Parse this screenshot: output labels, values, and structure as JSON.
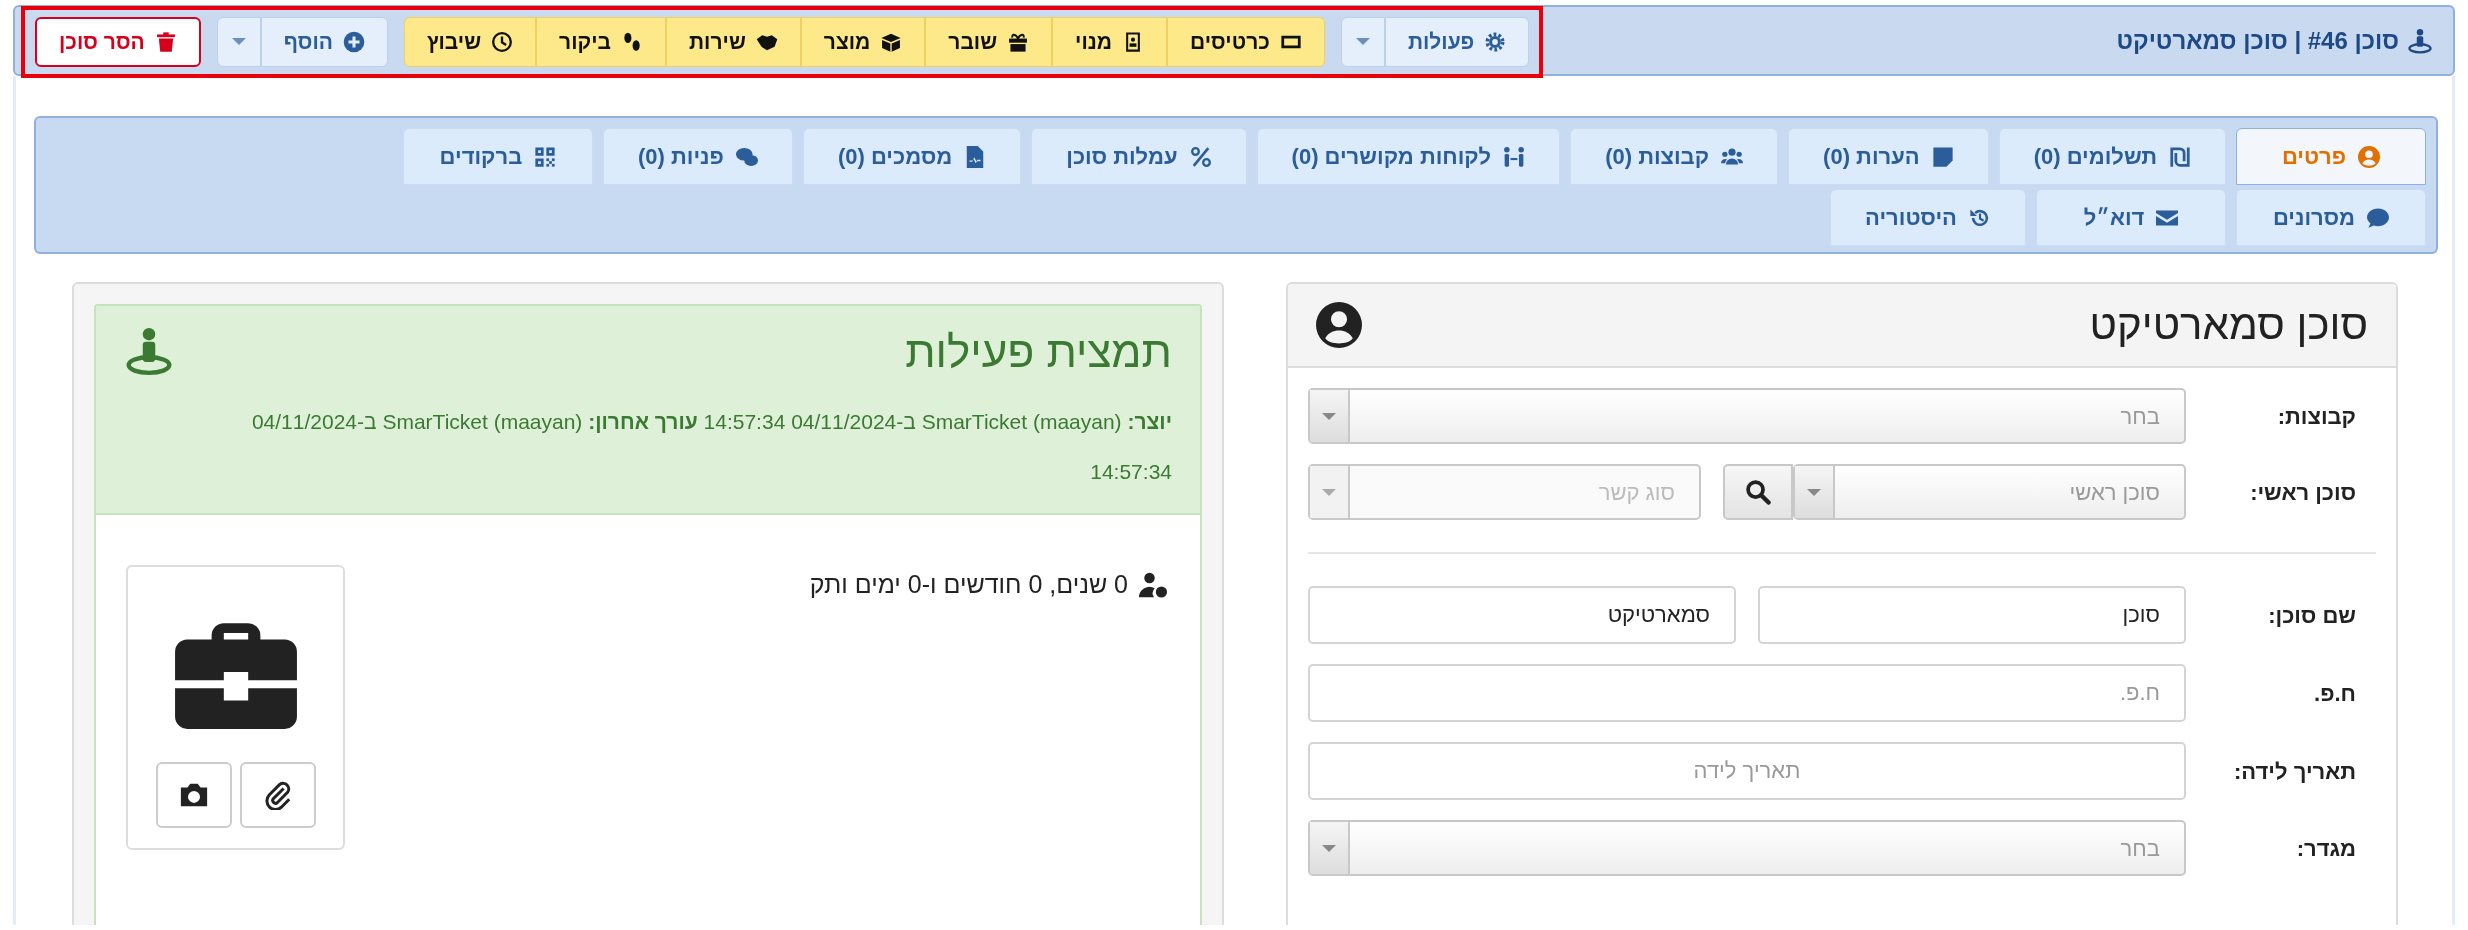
{
  "header": {
    "title": "סוכן #46 | סוכן סמארטיקט"
  },
  "toolbar": {
    "highlighted": true,
    "actions_button": {
      "label": "פעולות"
    },
    "quick_buttons": [
      {
        "label": "כרטיסים"
      },
      {
        "label": "מנוי"
      },
      {
        "label": "שובר"
      },
      {
        "label": "מוצר"
      },
      {
        "label": "שירות"
      },
      {
        "label": "ביקור"
      },
      {
        "label": "שיבוץ"
      }
    ],
    "add_button": {
      "label": "הוסף"
    },
    "remove_button": {
      "label": "הסר סוכן"
    }
  },
  "tab_rows": [
    [
      {
        "label": "פרטים",
        "selected": true
      },
      {
        "label": "תשלומים (0)",
        "selected": false
      },
      {
        "label": "הערות (0)",
        "selected": false
      },
      {
        "label": "קבוצות (0)",
        "selected": false
      },
      {
        "label": "לקוחות מקושרים (0)",
        "selected": false
      },
      {
        "label": "עמלות סוכן",
        "selected": false
      },
      {
        "label": "מסמכים (0)",
        "selected": false
      },
      {
        "label": "פניות (0)",
        "selected": false
      },
      {
        "label": "ברקודים",
        "selected": false
      }
    ],
    [
      {
        "label": "מסרונים",
        "selected": false
      },
      {
        "label": "דוא״ל",
        "selected": false
      },
      {
        "label": "היסטוריה",
        "selected": false
      }
    ]
  ],
  "agent_card": {
    "title": "סוכן סמארטיקט",
    "rows": [
      {
        "kind": "field",
        "label": "קבוצות:",
        "controls": [
          {
            "kind": "select",
            "placeholder": "בחר",
            "disabled": false
          }
        ]
      },
      {
        "kind": "field",
        "label": "סוכן ראשי:",
        "controls": [
          {
            "kind": "select",
            "placeholder": "סוכן ראשי",
            "disabled": false
          },
          {
            "kind": "search_button"
          },
          {
            "kind": "select",
            "placeholder": "סוג קשר",
            "disabled": true
          }
        ]
      },
      {
        "kind": "divider"
      },
      {
        "kind": "field",
        "label": "שם סוכן:",
        "controls": [
          {
            "kind": "input",
            "value": "סוכן"
          },
          {
            "kind": "input",
            "value": "סמארטיקט"
          }
        ]
      },
      {
        "kind": "field",
        "label": "ח.פ.",
        "controls": [
          {
            "kind": "input",
            "placeholder": "ח.פ."
          }
        ]
      },
      {
        "kind": "field",
        "label": "תאריך לידה:",
        "controls": [
          {
            "kind": "date",
            "placeholder": "תאריך לידה"
          }
        ]
      },
      {
        "kind": "field",
        "label": "מגדר:",
        "controls": [
          {
            "kind": "select",
            "placeholder": "בחר",
            "disabled": false
          }
        ]
      }
    ]
  },
  "summary_card": {
    "title": "תמצית פעילות",
    "meta": "**יוצר:** SmarTicket (maayan) ב-04/11/2024 14:57:34 **עורך אחרון:** SmarTicket (maayan) ב-04/11/2024 14:57:34",
    "seniority": "0 שנים, 0 חודשים ו-0 ימים ותק"
  }
}
